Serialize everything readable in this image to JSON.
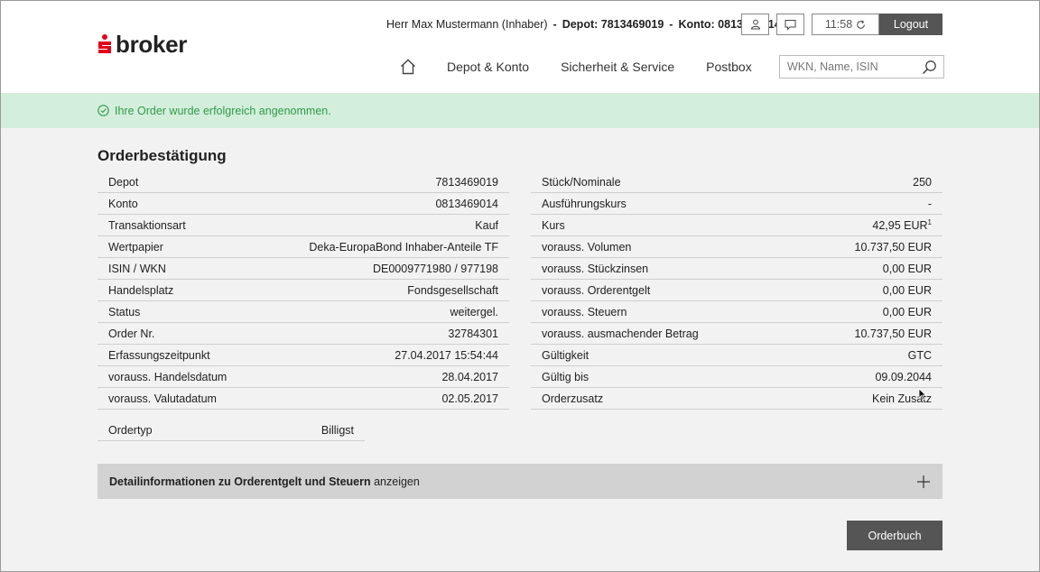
{
  "header": {
    "brand_symbol": "ṡ",
    "brand_name": "broker",
    "user_name": "Herr Max Mustermann (Inhaber)",
    "depot_label": "Depot: 7813469019",
    "konto_label": "Konto: 0813469014",
    "separator": "-",
    "time": "11:58",
    "logout_label": "Logout",
    "icons": [
      "user-icon",
      "message-icon",
      "refresh-icon",
      "home-icon",
      "search-icon"
    ]
  },
  "nav": {
    "items": [
      {
        "label": "Depot & Konto"
      },
      {
        "label": "Sicherheit & Service"
      },
      {
        "label": "Postbox"
      }
    ]
  },
  "search": {
    "placeholder": "WKN, Name, ISIN",
    "value": ""
  },
  "banner": {
    "message": "Ihre Order wurde erfolgreich angenommen."
  },
  "page": {
    "title": "Orderbestätigung"
  },
  "left_table": [
    {
      "label": "Depot",
      "value": "7813469019"
    },
    {
      "label": "Konto",
      "value": "0813469014"
    },
    {
      "label": "Transaktionsart",
      "value": "Kauf"
    },
    {
      "label": "Wertpapier",
      "value": "Deka-EuropaBond Inhaber-Anteile TF"
    },
    {
      "label": "ISIN / WKN",
      "value": "DE0009771980 / 977198"
    },
    {
      "label": "Handelsplatz",
      "value": "Fondsgesellschaft"
    },
    {
      "label": "Status",
      "value": "weitergel."
    },
    {
      "label": "Order Nr.",
      "value": "32784301"
    },
    {
      "label": "Erfassungszeitpunkt",
      "value": "27.04.2017 15:54:44"
    },
    {
      "label": "vorauss. Handelsdatum",
      "value": "28.04.2017"
    },
    {
      "label": "vorauss. Valutadatum",
      "value": "02.05.2017"
    }
  ],
  "right_table": [
    {
      "label": "Stück/Nominale",
      "value": "250"
    },
    {
      "label": "Ausführungskurs",
      "value": "-"
    },
    {
      "label": "Kurs",
      "value": "42,95 EUR",
      "footnote": "1"
    },
    {
      "label": "vorauss. Volumen",
      "value": "10.737,50 EUR"
    },
    {
      "label": "vorauss. Stückzinsen",
      "value": "0,00 EUR"
    },
    {
      "label": "vorauss. Orderentgelt",
      "value": "0,00 EUR"
    },
    {
      "label": "vorauss. Steuern",
      "value": "0,00 EUR"
    },
    {
      "label": "vorauss. ausmachender Betrag",
      "value": "10.737,50 EUR"
    },
    {
      "label": "Gültigkeit",
      "value": "GTC"
    },
    {
      "label": "Gültig bis",
      "value": "09.09.2044"
    },
    {
      "label": "Orderzusatz",
      "value": "Kein Zusatz"
    }
  ],
  "ordertyp": {
    "label": "Ordertyp",
    "value": "Billigst"
  },
  "details": {
    "bold_text": "Detailinformationen zu Orderentgelt und Steuern",
    "suffix_text": "anzeigen",
    "toggle_icon": "plus-icon"
  },
  "actions": {
    "orderbuch_label": "Orderbuch"
  },
  "colors": {
    "brand_red": "#e2001a",
    "banner_bg": "#d4eedc",
    "banner_text": "#2e9b4a",
    "button_dark": "#555555",
    "page_bg": "#f2f2f2"
  }
}
